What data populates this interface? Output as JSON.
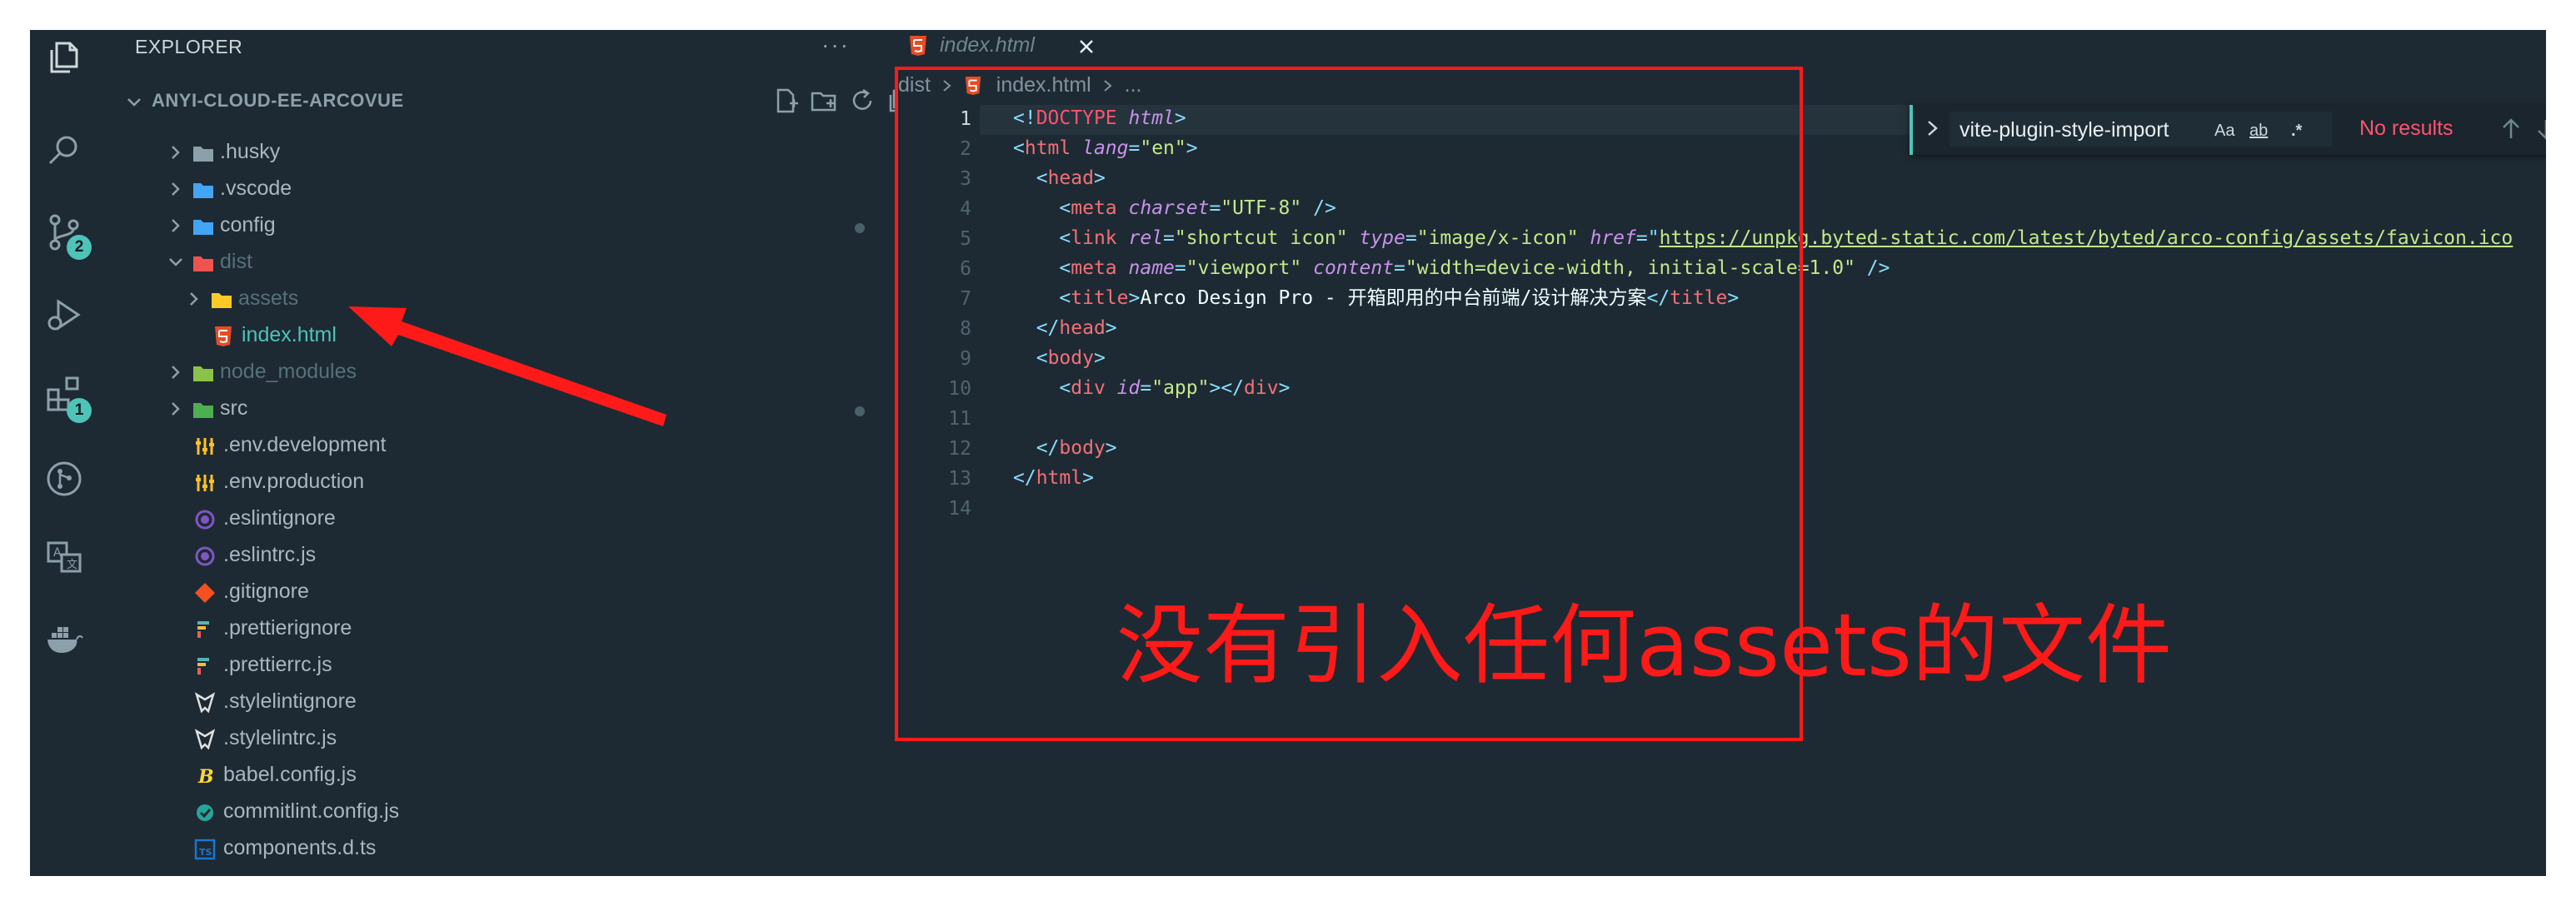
{
  "sidebar": {
    "title": "EXPLORER",
    "more": "···",
    "root": "ANYI-CLOUD-EE-ARCOVUE",
    "tree": [
      {
        "name": ".husky",
        "type": "folder",
        "expanded": false,
        "color": "#8ca0ab"
      },
      {
        "name": ".vscode",
        "type": "folder",
        "expanded": false,
        "color": "#42a5f5"
      },
      {
        "name": "config",
        "type": "folder",
        "expanded": false,
        "color": "#42a5f5"
      },
      {
        "name": "dist",
        "type": "folder",
        "expanded": true,
        "color": "#ef5350"
      },
      {
        "name": "assets",
        "type": "folder",
        "expanded": false,
        "color": "#ffca28"
      },
      {
        "name": "index.html",
        "type": "html",
        "color": "#e44d26"
      },
      {
        "name": "node_modules",
        "type": "folder",
        "expanded": false,
        "color": "#8bc34a"
      },
      {
        "name": "src",
        "type": "folder",
        "expanded": false,
        "color": "#4caf50"
      },
      {
        "name": ".env.development",
        "type": "env",
        "color": "#fbc02d"
      },
      {
        "name": ".env.production",
        "type": "env",
        "color": "#fbc02d"
      },
      {
        "name": ".eslintignore",
        "type": "eslint",
        "color": "#7e57c2"
      },
      {
        "name": ".eslintrc.js",
        "type": "eslint",
        "color": "#7e57c2"
      },
      {
        "name": ".gitignore",
        "type": "git",
        "color": "#f4511e"
      },
      {
        "name": ".prettierignore",
        "type": "prettier",
        "color": "#56b3b4"
      },
      {
        "name": ".prettierrc.js",
        "type": "prettier",
        "color": "#56b3b4"
      },
      {
        "name": ".stylelintignore",
        "type": "stylelint",
        "color": "#e0e0e0"
      },
      {
        "name": ".stylelintrc.js",
        "type": "stylelint",
        "color": "#e0e0e0"
      },
      {
        "name": "babel.config.js",
        "type": "babel",
        "color": "#fdd835"
      },
      {
        "name": "commitlint.config.js",
        "type": "commitlint",
        "color": "#26a69a"
      },
      {
        "name": "components.d.ts",
        "type": "ts",
        "color": "#1976d2"
      },
      {
        "name": "index.html",
        "type": "html",
        "color": "#e44d26"
      }
    ]
  },
  "activity": {
    "scm_badge": "2",
    "ext_badge": "1"
  },
  "editor": {
    "tab_label": "index.html",
    "breadcrumb_folder": "dist",
    "breadcrumb_file": "index.html",
    "breadcrumb_more": "...",
    "line_numbers": [
      "1",
      "2",
      "3",
      "4",
      "5",
      "6",
      "7",
      "8",
      "9",
      "10",
      "11",
      "12",
      "13",
      "14"
    ],
    "active_line": "1"
  },
  "find": {
    "value": "vite-plugin-style-import",
    "opt_case": "Aa",
    "opt_word": "ab",
    "opt_regex": ".*",
    "result": "No results"
  },
  "annotation": {
    "text": "没有引入任何assets的文件"
  },
  "code": {
    "l1_a": "<!",
    "l1_b": "DOCTYPE",
    "l1_c": "html",
    "l1_d": ">",
    "l2_attr": "lang",
    "l2_val": "\"en\"",
    "l4_attr": "charset",
    "l4_val": "\"UTF-8\"",
    "l5_rel": "rel",
    "l5_rel_val": "\"shortcut icon\"",
    "l5_type": "type",
    "l5_type_val": "\"image/x-icon\"",
    "l5_href": "href",
    "l5_url": "https://unpkg.byted-static.com/latest/byted/arco-config/assets/favicon.ico",
    "l6_name": "name",
    "l6_name_val": "\"viewport\"",
    "l6_content": "content",
    "l6_content_val": "\"width=device-width, initial-scale=1.0\"",
    "l7_title": "Arco Design Pro - 开箱即用的中台前端/设计解决方案",
    "l10_attr": "id",
    "l10_val": "\"app\""
  }
}
